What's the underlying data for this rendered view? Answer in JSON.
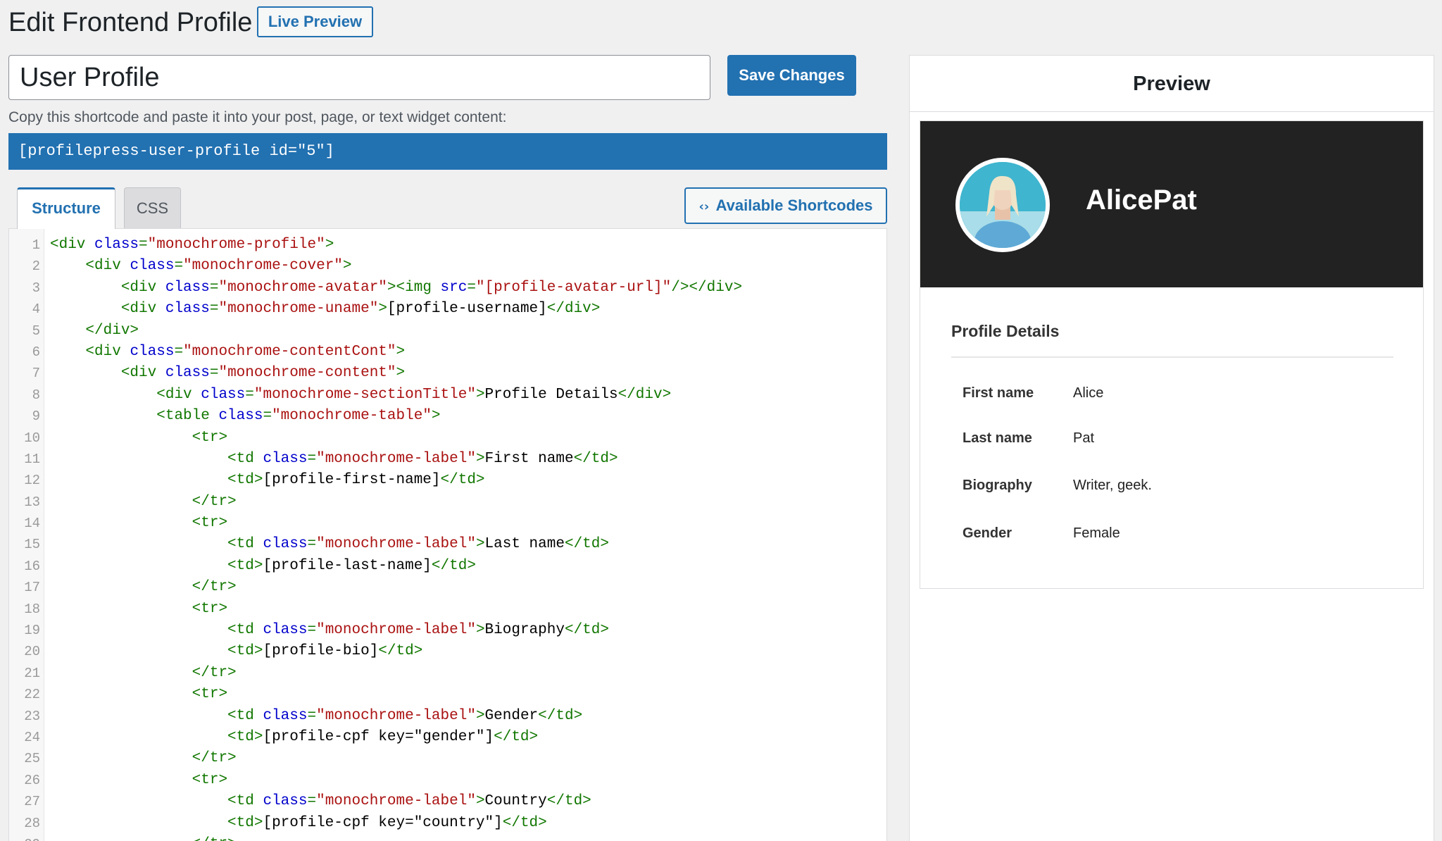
{
  "header": {
    "title": "Edit Frontend Profile",
    "live_preview_label": "Live Preview"
  },
  "form": {
    "name_value": "User Profile",
    "save_label": "Save Changes",
    "copy_note": "Copy this shortcode and paste it into your post, page, or text widget content:",
    "shortcode": "[profilepress-user-profile id=\"5\"]"
  },
  "tabs": [
    {
      "label": "Structure",
      "active": true
    },
    {
      "label": "CSS",
      "active": false
    }
  ],
  "available_shortcodes_label": "Available Shortcodes",
  "editor": {
    "lines": [
      "<div class=\"monochrome-profile\">",
      "    <div class=\"monochrome-cover\">",
      "        <div class=\"monochrome-avatar\"><img src=\"[profile-avatar-url]\"/></div>",
      "        <div class=\"monochrome-uname\">[profile-username]</div>",
      "    </div>",
      "    <div class=\"monochrome-contentCont\">",
      "        <div class=\"monochrome-content\">",
      "            <div class=\"monochrome-sectionTitle\">Profile Details</div>",
      "            <table class=\"monochrome-table\">",
      "                <tr>",
      "                    <td class=\"monochrome-label\">First name</td>",
      "                    <td>[profile-first-name]</td>",
      "                </tr>",
      "                <tr>",
      "                    <td class=\"monochrome-label\">Last name</td>",
      "                    <td>[profile-last-name]</td>",
      "                </tr>",
      "                <tr>",
      "                    <td class=\"monochrome-label\">Biography</td>",
      "                    <td>[profile-bio]</td>",
      "                </tr>",
      "                <tr>",
      "                    <td class=\"monochrome-label\">Gender</td>",
      "                    <td>[profile-cpf key=\"gender\"]</td>",
      "                </tr>",
      "                <tr>",
      "                    <td class=\"monochrome-label\">Country</td>",
      "                    <td>[profile-cpf key=\"country\"]</td>",
      "                </tr>"
    ]
  },
  "preview": {
    "heading": "Preview",
    "username": "AlicePat",
    "section_title": "Profile Details",
    "rows": [
      {
        "label": "First name",
        "value": "Alice"
      },
      {
        "label": "Last name",
        "value": "Pat"
      },
      {
        "label": "Biography",
        "value": "Writer, geek."
      },
      {
        "label": "Gender",
        "value": "Female"
      }
    ]
  },
  "colors": {
    "accent": "#2271b1",
    "cover": "#222222",
    "avatar_bg": "#3fb5cf"
  }
}
